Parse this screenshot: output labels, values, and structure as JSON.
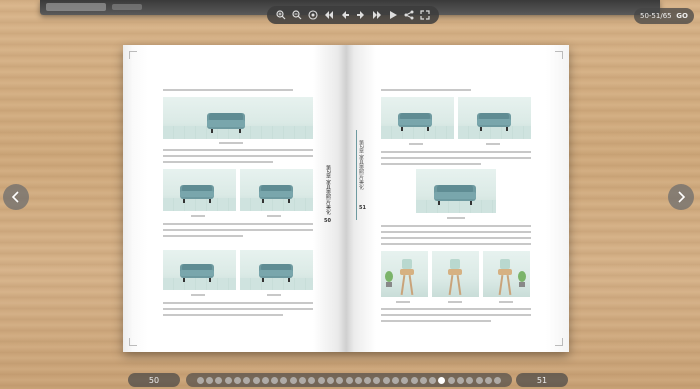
{
  "toolbar": {
    "buttons": [
      {
        "name": "zoom-in-icon"
      },
      {
        "name": "zoom-out-icon"
      },
      {
        "name": "fit-icon"
      },
      {
        "name": "first-page-icon"
      },
      {
        "name": "prev-page-icon"
      },
      {
        "name": "next-page-icon"
      },
      {
        "name": "last-page-icon"
      },
      {
        "name": "play-icon"
      },
      {
        "name": "share-icon"
      },
      {
        "name": "fullscreen-icon"
      }
    ]
  },
  "page_indicator": {
    "current": "50-51/65",
    "go_label": "GO"
  },
  "book": {
    "left_page_number": "50",
    "right_page_number": "51",
    "spine_title": "第2章 家具类照片美化"
  },
  "bottom": {
    "left_pill": "50",
    "right_pill": "51",
    "dot_count": 33,
    "active_dot": 26
  },
  "colors": {
    "accent": "#6e9aa0",
    "bar": "#464646"
  }
}
